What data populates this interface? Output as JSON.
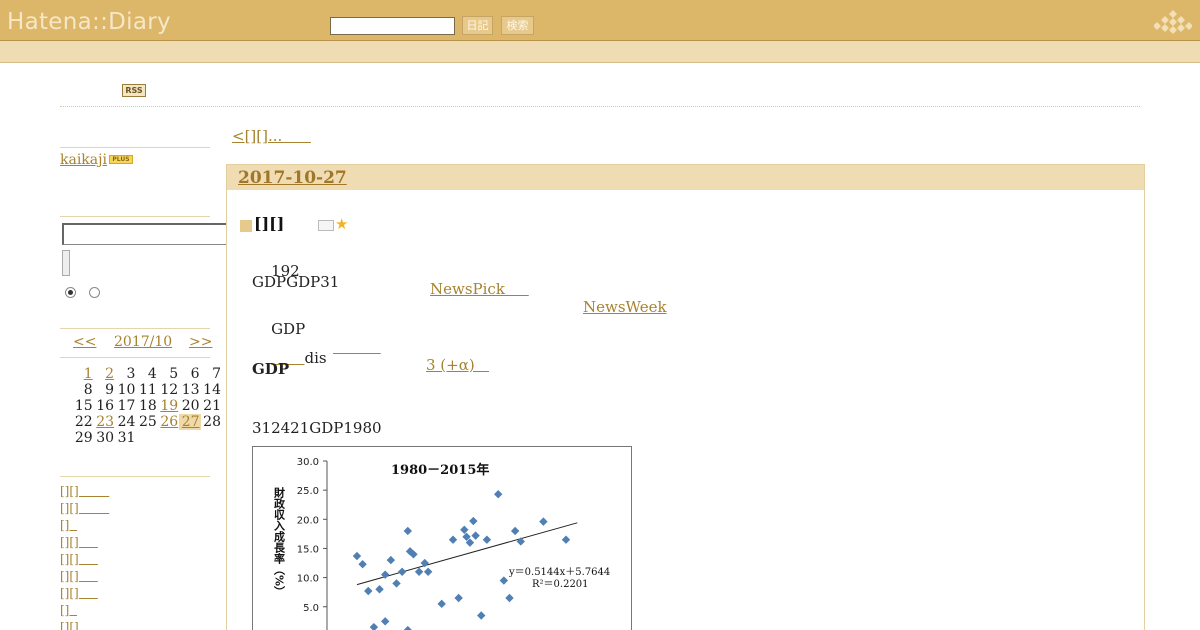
{
  "topbar": {
    "logo": "Hatena::Diary",
    "search_value": "",
    "diary_button": "日記",
    "search_button": "検索"
  },
  "header": {
    "rss": "RSS"
  },
  "sidebar": {
    "user": "kaikaji",
    "plus": "PLUS",
    "search_value": "",
    "calendar": {
      "prev": "<<",
      "month": "2017/10",
      "next": ">>",
      "weeks": [
        [
          "",
          "1",
          "2",
          "3",
          "4",
          "5",
          "6",
          "7"
        ],
        [
          "8",
          "9",
          "10",
          "11",
          "12",
          "13",
          "14"
        ],
        [
          "15",
          "16",
          "17",
          "18",
          "19",
          "20",
          "21"
        ],
        [
          "22",
          "23",
          "24",
          "25",
          "26",
          "27",
          "28"
        ],
        [
          "29",
          "30",
          "31"
        ]
      ]
    },
    "categories": [
      "[][]        ",
      "[][]        ",
      "[]  ",
      "[][]     ",
      "[][]     ",
      "[][]     ",
      "[][]     ",
      "[]  ",
      "[][]   "
    ]
  },
  "main": {
    "prev_link": "<[][]...      ",
    "date": "2017-10-27",
    "section_title": "[][]",
    "lines": {
      "l1_text": "192",
      "l1_link1": "NewsPick     ",
      "l1_link2": "NewsWeek",
      "l2": "GDPGDP31",
      "l3_text": "GDP",
      "l3_link1": "          ",
      "l3_link2": "3 (+α)   ",
      "l4_link": "       ",
      "l4_text": "dis",
      "l5": "GDP",
      "l6": "312421GDP1980"
    }
  },
  "chart_data": {
    "type": "scatter",
    "title": "1980－2015年",
    "ylabel": "財政収入成長率（%）",
    "ylim": [
      0,
      30
    ],
    "yticks": [
      "30.0",
      "25.0",
      "20.0",
      "15.0",
      "10.0",
      "5.0"
    ],
    "equation": "y＝0.5144x＋5.7644",
    "r2": "R²＝0.2201",
    "points": [
      [
        -8.5,
        13.7
      ],
      [
        -8.0,
        12.3
      ],
      [
        -7.5,
        7.7
      ],
      [
        -6.5,
        8.0
      ],
      [
        -6.0,
        10.5
      ],
      [
        -5.5,
        13.0
      ],
      [
        -5.0,
        9.0
      ],
      [
        -4.5,
        11.0
      ],
      [
        -4.0,
        18.0
      ],
      [
        -3.8,
        14.5
      ],
      [
        -3.5,
        14.0
      ],
      [
        -3.0,
        11.0
      ],
      [
        -2.5,
        12.5
      ],
      [
        -2.2,
        11.0
      ],
      [
        -1.0,
        5.5
      ],
      [
        0.0,
        16.5
      ],
      [
        0.5,
        6.5
      ],
      [
        1.0,
        18.2
      ],
      [
        1.2,
        17.0
      ],
      [
        1.5,
        16.0
      ],
      [
        1.8,
        19.7
      ],
      [
        2.0,
        17.2
      ],
      [
        2.5,
        3.5
      ],
      [
        3.0,
        16.5
      ],
      [
        4.0,
        24.3
      ],
      [
        4.5,
        9.5
      ],
      [
        5.0,
        6.5
      ],
      [
        5.5,
        18.0
      ],
      [
        6.0,
        16.2
      ],
      [
        8.0,
        19.6
      ],
      [
        10.0,
        16.5
      ],
      [
        -7.0,
        1.5
      ],
      [
        -6.0,
        2.5
      ],
      [
        -4.0,
        1.0
      ]
    ]
  }
}
